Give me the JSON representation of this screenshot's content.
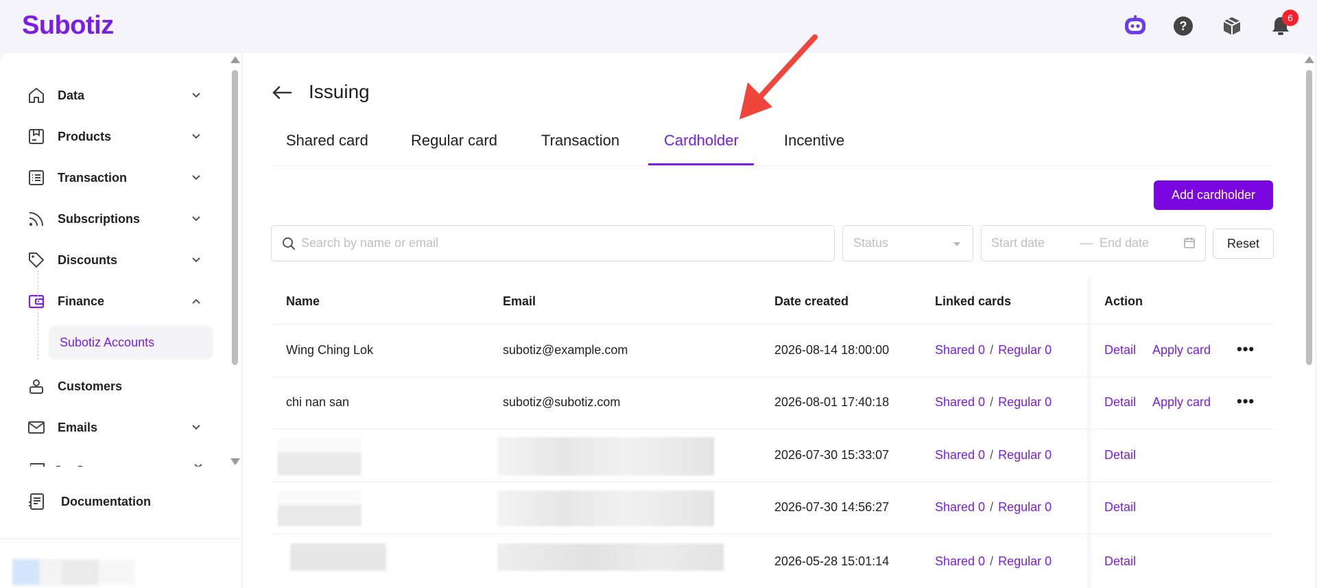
{
  "header": {
    "logo": "Subotiz",
    "notification_count": "6",
    "colors": {
      "brand": "#7a1de6",
      "badge": "#f5222d"
    }
  },
  "sidebar": {
    "items": [
      {
        "label": "Data",
        "icon": "home-icon",
        "expanded": false
      },
      {
        "label": "Products",
        "icon": "products-icon",
        "expanded": false
      },
      {
        "label": "Transaction",
        "icon": "list-icon",
        "expanded": false
      },
      {
        "label": "Subscriptions",
        "icon": "rss-icon",
        "expanded": false
      },
      {
        "label": "Discounts",
        "icon": "tag-icon",
        "expanded": false
      },
      {
        "label": "Finance",
        "icon": "wallet-icon",
        "expanded": true
      },
      {
        "label": "Customers",
        "icon": "user-icon",
        "expanded": false
      },
      {
        "label": "Emails",
        "icon": "mail-icon",
        "expanded": false
      }
    ],
    "finance_sub": "Subotiz Accounts",
    "documentation": "Documentation"
  },
  "page": {
    "title": "Issuing",
    "tabs": [
      "Shared card",
      "Regular card",
      "Transaction",
      "Cardholder",
      "Incentive"
    ],
    "active_tab": "Cardholder",
    "add_button": "Add cardholder",
    "search_placeholder": "Search by name or email",
    "status_placeholder": "Status",
    "start_date_placeholder": "Start date",
    "end_date_placeholder": "End date",
    "date_separator": "—",
    "reset_button": "Reset"
  },
  "table": {
    "columns": [
      "Name",
      "Email",
      "Date created",
      "Linked cards",
      "Action"
    ],
    "rows": [
      {
        "name": "Wing Ching Lok",
        "email": "subotiz@example.com",
        "date": "2026-08-14 18:00:00",
        "shared": "Shared 0",
        "regular": "Regular 0",
        "detail": "Detail",
        "apply": "Apply card",
        "more": "•••"
      },
      {
        "name": "chi nan san",
        "email": "subotiz@subotiz.com",
        "date": "2026-08-01 17:40:18",
        "shared": "Shared 0",
        "regular": "Regular 0",
        "detail": "Detail",
        "apply": "Apply card",
        "more": "•••"
      },
      {
        "name": "",
        "email": "",
        "date": "2026-07-30 15:33:07",
        "shared": "Shared 0",
        "regular": "Regular 0",
        "detail": "Detail"
      },
      {
        "name": "",
        "email": "",
        "date": "2026-07-30 14:56:27",
        "shared": "Shared 0",
        "regular": "Regular 0",
        "detail": "Detail"
      },
      {
        "name": "",
        "email": "",
        "date": "2026-05-28 15:01:14",
        "shared": "Shared 0",
        "regular": "Regular 0",
        "detail": "Detail"
      }
    ],
    "slash": "/"
  }
}
